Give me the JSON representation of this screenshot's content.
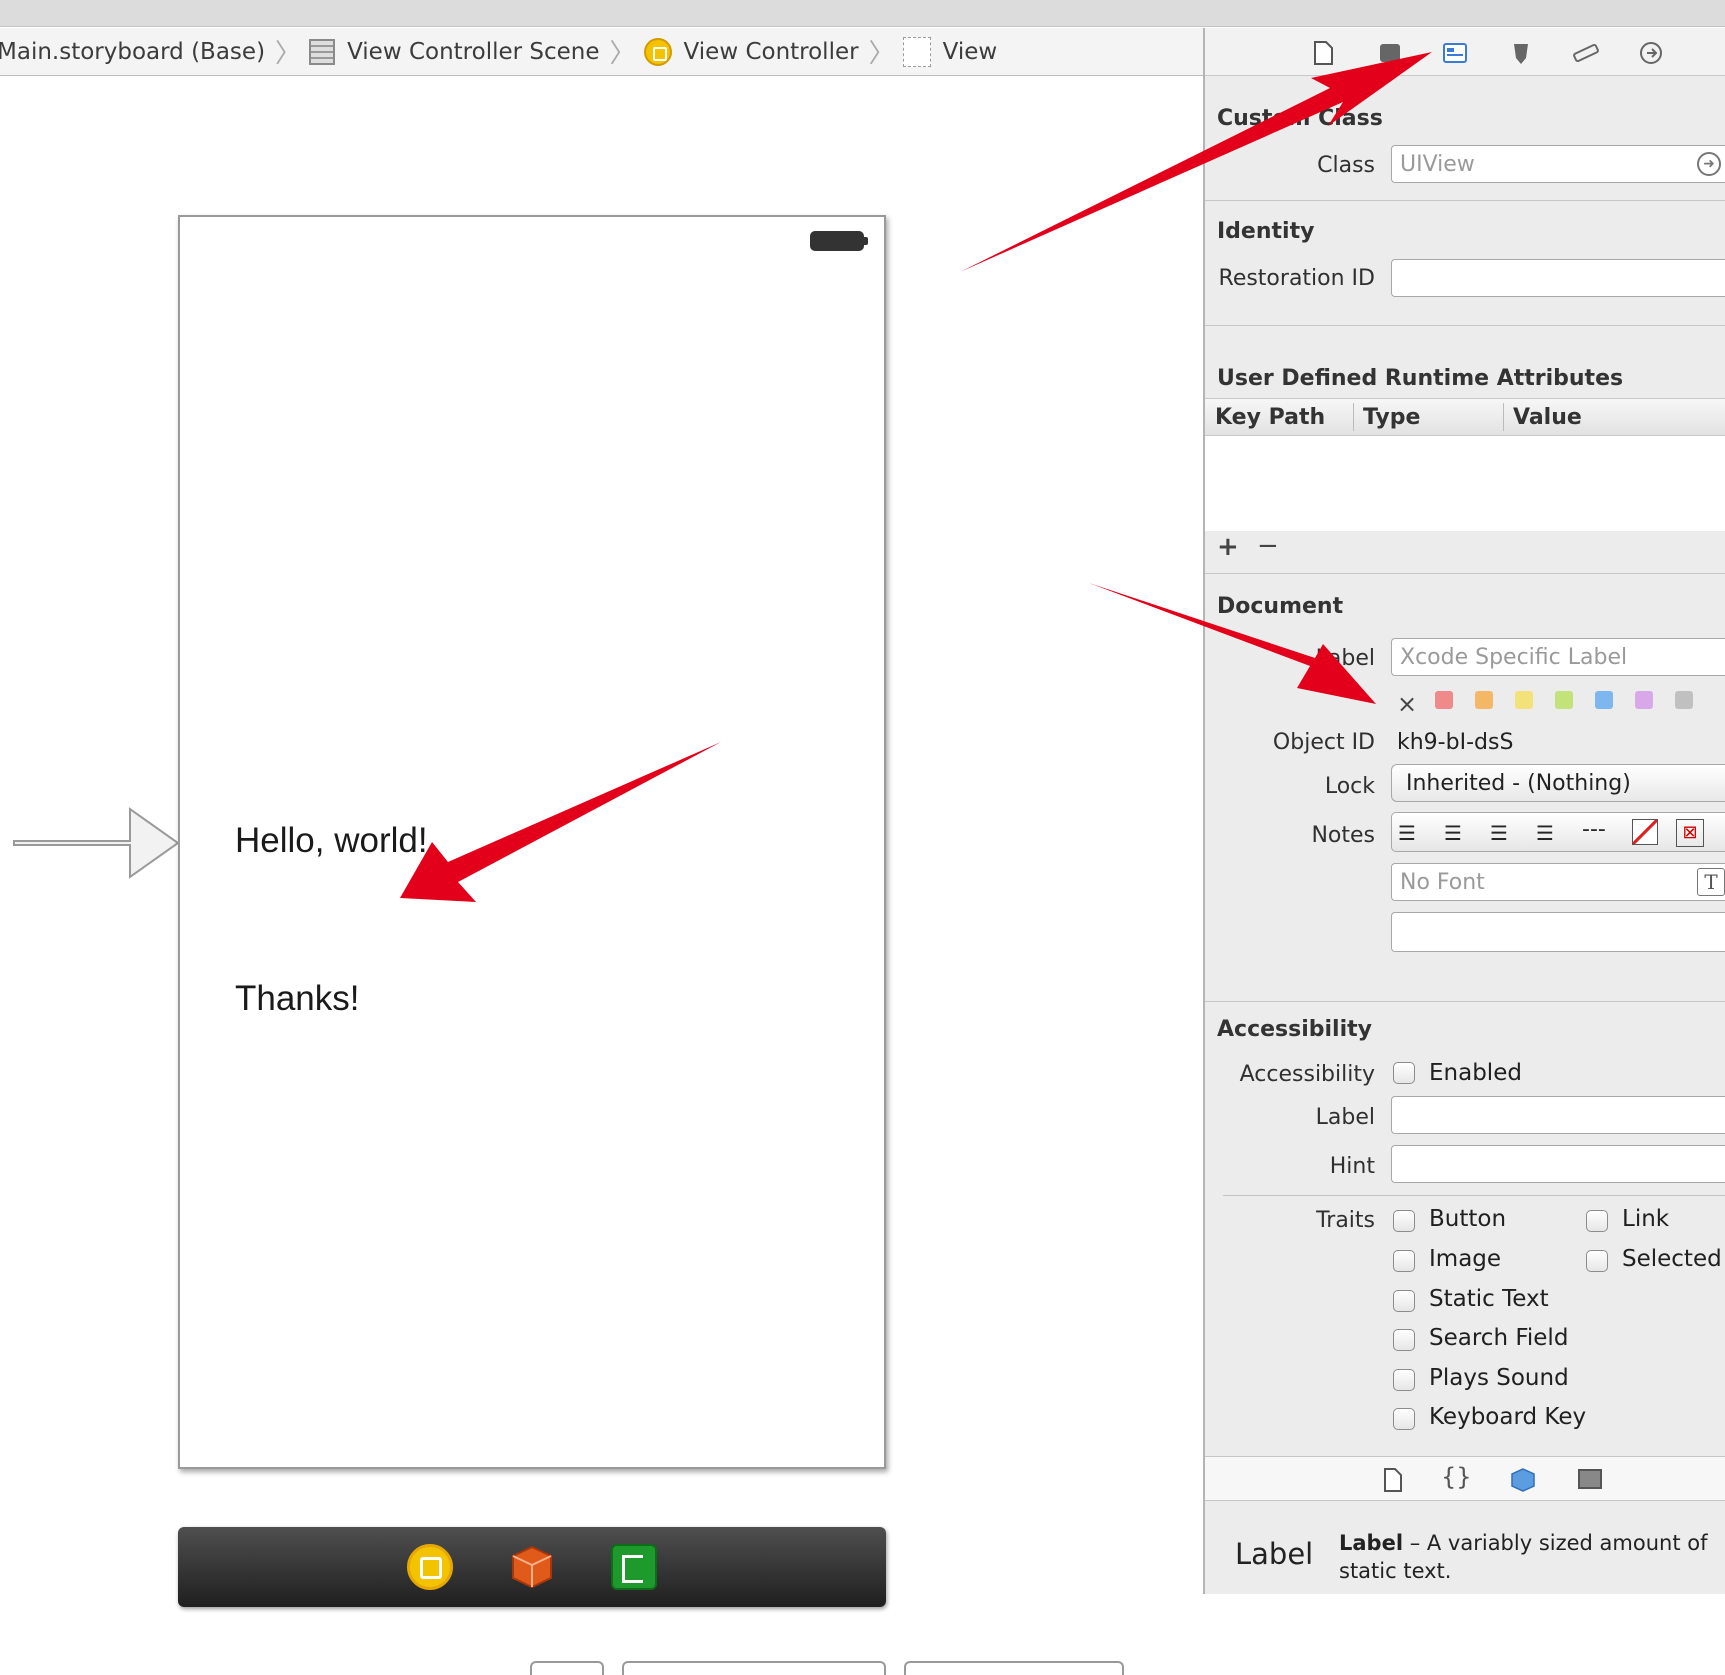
{
  "breadcrumb": {
    "storyboard": "Main.storyboard (Base)",
    "scene": "View Controller Scene",
    "controller": "View Controller",
    "view": "View"
  },
  "canvas": {
    "label_hello": "Hello, world!",
    "label_thanks": "Thanks!"
  },
  "inspector": {
    "custom_class": {
      "header": "Custom Class",
      "class_label": "Class",
      "class_placeholder": "UIView"
    },
    "identity": {
      "header": "Identity",
      "restoration_label": "Restoration ID"
    },
    "runtime": {
      "header": "User Defined Runtime Attributes",
      "columns": [
        "Key Path",
        "Type",
        "Value"
      ],
      "add": "+",
      "remove": "−"
    },
    "document": {
      "header": "Document",
      "label_label": "Label",
      "label_placeholder": "Xcode Specific Label",
      "clear_color": "×",
      "colors": [
        "#f08a8a",
        "#f4b766",
        "#f3e27a",
        "#c3e27a",
        "#7eb6f0",
        "#d8a8e8",
        "#c0c0c0"
      ],
      "object_id_label": "Object ID",
      "object_id": "kh9-bI-dsS",
      "lock_label": "Lock",
      "lock_value": "Inherited - (Nothing)",
      "notes_label": "Notes",
      "notes_dashes": "---",
      "font_placeholder": "No Font"
    },
    "accessibility": {
      "header": "Accessibility",
      "acc_label": "Accessibility",
      "enabled": "Enabled",
      "label_label": "Label",
      "hint_label": "Hint",
      "traits_label": "Traits",
      "traits": [
        "Button",
        "Link",
        "Image",
        "Selected",
        "Static Text",
        "Search Field",
        "Plays Sound",
        "Keyboard Key"
      ]
    },
    "library": {
      "item_title": "Label",
      "item_name": "Label",
      "item_desc_1": " – A variably sized amount of",
      "item_desc_2": "static text."
    }
  }
}
